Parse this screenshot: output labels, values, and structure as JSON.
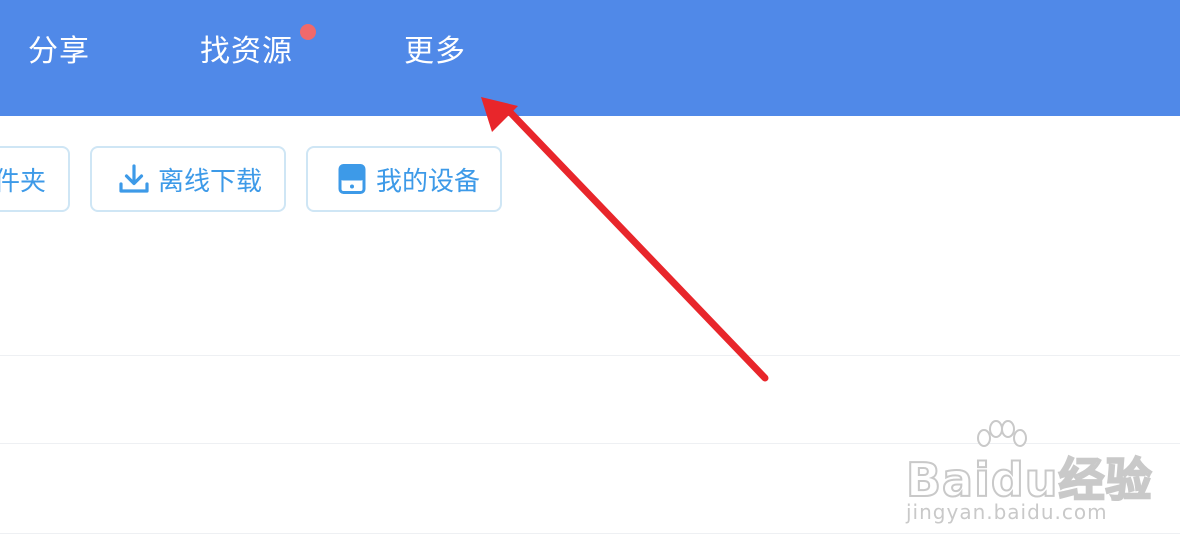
{
  "nav": {
    "tabs": [
      {
        "label": "分享"
      },
      {
        "label": "找资源"
      },
      {
        "label": "更多"
      }
    ],
    "badge_color": "#f0696b",
    "bar_color": "#5089e8"
  },
  "toolbar": {
    "folder_label": "件夹",
    "offline_label": "离线下载",
    "offline_icon": "download-icon",
    "device_label": "我的设备",
    "device_icon": "device-icon",
    "accent_color": "#3d9ae8"
  },
  "annotation": {
    "arrow_color": "#e8262b"
  },
  "watermark": {
    "brand": "Baidu经验",
    "site": "jingyan.baidu.com"
  }
}
